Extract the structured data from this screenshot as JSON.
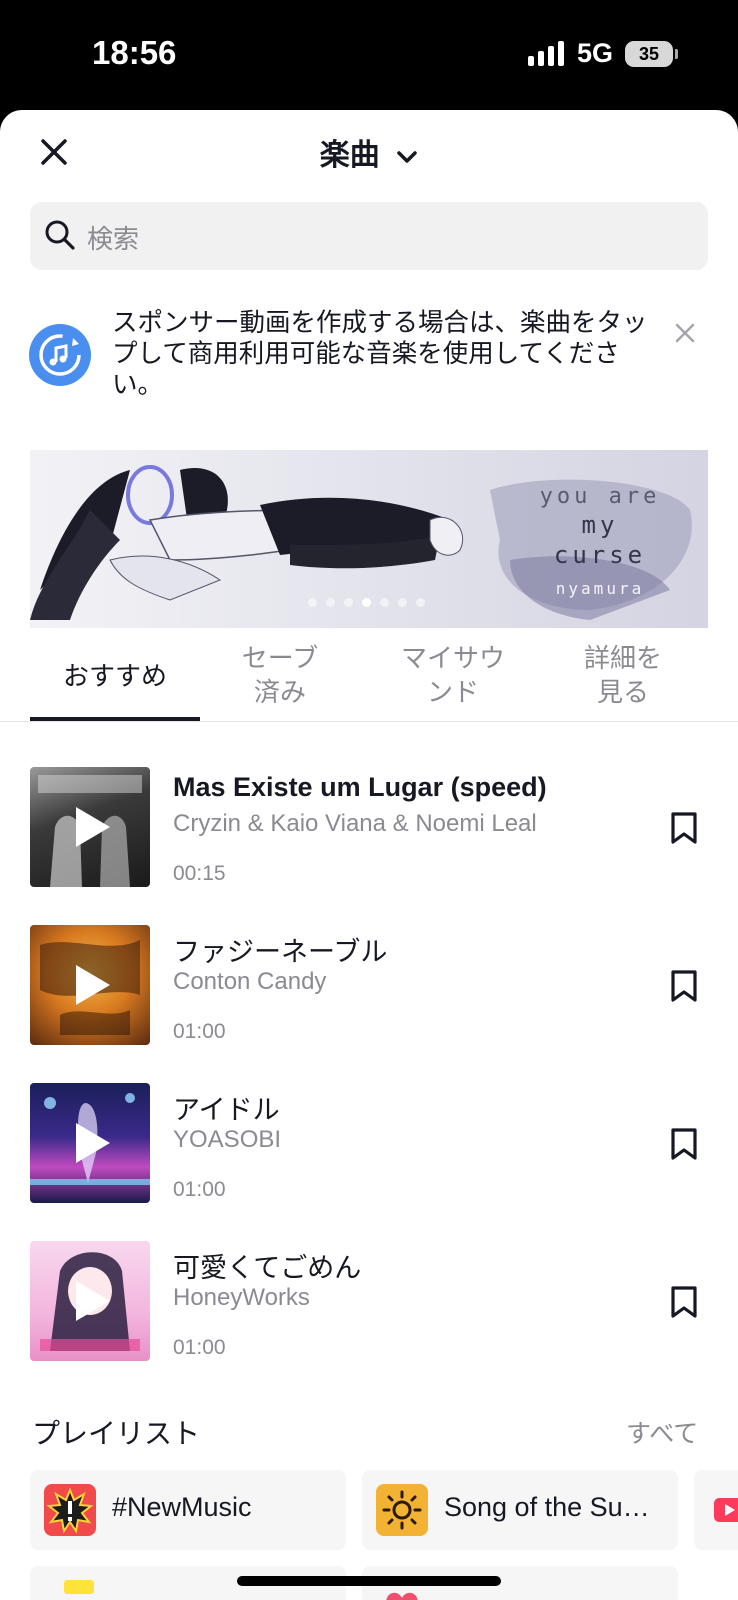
{
  "status_bar": {
    "time": "18:56",
    "network": "5G",
    "battery": "35"
  },
  "header": {
    "title": "楽曲"
  },
  "search": {
    "placeholder": "検索"
  },
  "notice": {
    "text": "スポンサー動画を作成する場合は、楽曲をタップして商用利用可能な音楽を使用してください。"
  },
  "banner": {
    "line1": "you are",
    "line2": "my",
    "line3": "curse",
    "credit": "nyamura",
    "slide_count": 7,
    "active_slide": 4
  },
  "tabs": [
    {
      "label": "おすすめ",
      "active": true
    },
    {
      "label": "セーブ済み",
      "active": false
    },
    {
      "label": "マイサウンド",
      "active": false
    },
    {
      "label": "詳細を見る",
      "active": false
    }
  ],
  "tracks": [
    {
      "title": "Mas Existe um Lugar (speed)",
      "artist": "Cryzin & Kaio Viana & Noemi Leal",
      "duration": "00:15"
    },
    {
      "title": "ファジーネーブル",
      "artist": "Conton Candy",
      "duration": "01:00"
    },
    {
      "title": "アイドル",
      "artist": "YOASOBI",
      "duration": "01:00"
    },
    {
      "title": "可愛くてごめん",
      "artist": "HoneyWorks",
      "duration": "01:00"
    }
  ],
  "playlists": {
    "heading": "プレイリスト",
    "see_all": "すべて",
    "items": [
      {
        "label": "#NewMusic",
        "icon": "burst-icon",
        "color": "#f04a4a"
      },
      {
        "label": "Song of the Su…",
        "icon": "sun-icon",
        "color": "#f2b233"
      }
    ]
  },
  "colors": {
    "accent": "#161823",
    "secondary_text": "#8a8b91",
    "notice_icon": "#4a8ff0"
  }
}
